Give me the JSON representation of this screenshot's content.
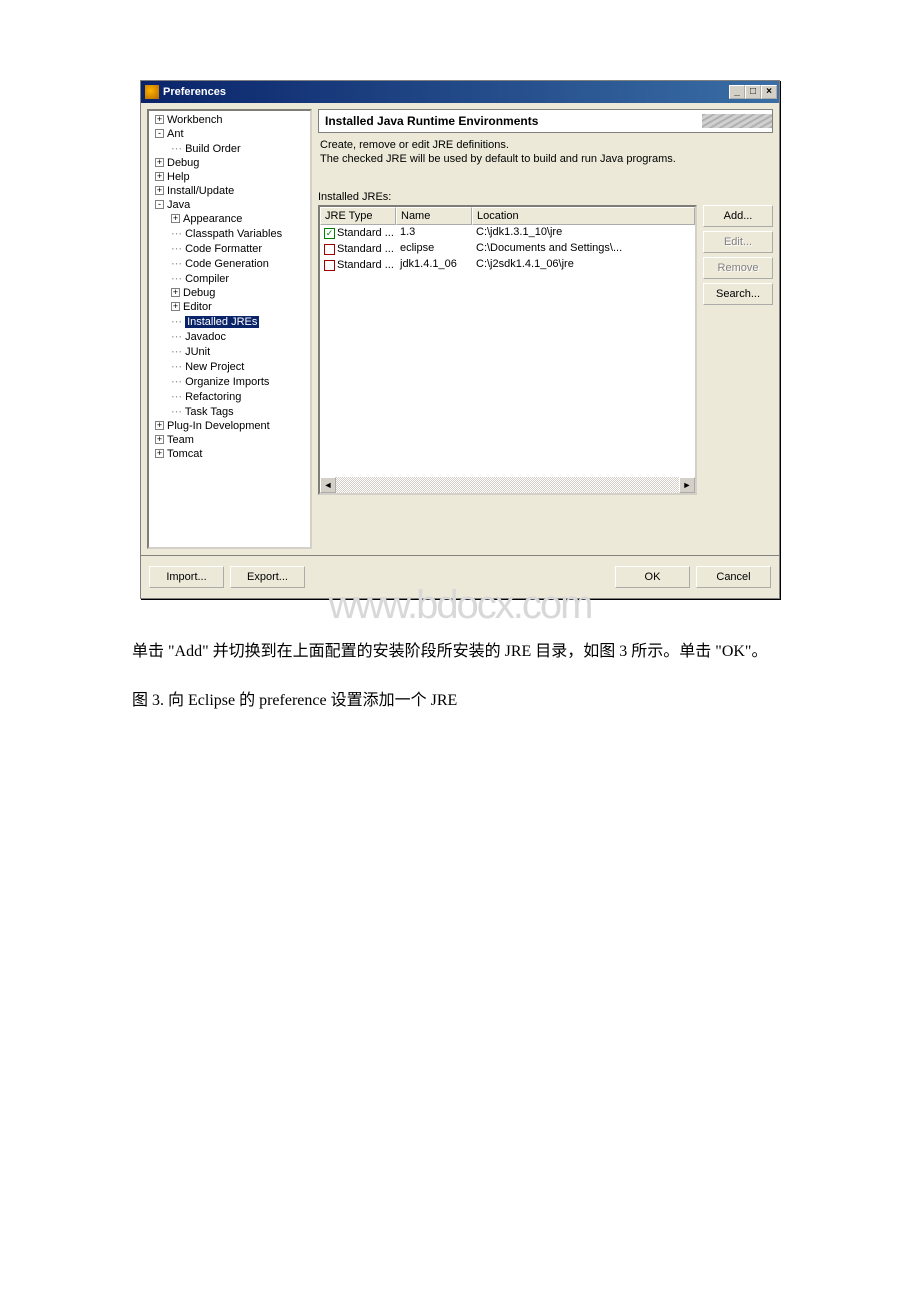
{
  "dialog": {
    "title": "Preferences",
    "titlebar_buttons": {
      "min": "_",
      "max": "□",
      "close": "×"
    }
  },
  "tree": {
    "items": [
      {
        "level": 0,
        "expander": "+",
        "label": "Workbench"
      },
      {
        "level": 0,
        "expander": "-",
        "label": "Ant"
      },
      {
        "level": 1,
        "expander": "",
        "label": "Build Order",
        "leaf": true
      },
      {
        "level": 0,
        "expander": "+",
        "label": "Debug"
      },
      {
        "level": 0,
        "expander": "+",
        "label": "Help"
      },
      {
        "level": 0,
        "expander": "+",
        "label": "Install/Update"
      },
      {
        "level": 0,
        "expander": "-",
        "label": "Java"
      },
      {
        "level": 1,
        "expander": "+",
        "label": "Appearance"
      },
      {
        "level": 1,
        "expander": "",
        "label": "Classpath Variables",
        "leaf": true
      },
      {
        "level": 1,
        "expander": "",
        "label": "Code Formatter",
        "leaf": true
      },
      {
        "level": 1,
        "expander": "",
        "label": "Code Generation",
        "leaf": true
      },
      {
        "level": 1,
        "expander": "",
        "label": "Compiler",
        "leaf": true
      },
      {
        "level": 1,
        "expander": "+",
        "label": "Debug"
      },
      {
        "level": 1,
        "expander": "+",
        "label": "Editor"
      },
      {
        "level": 1,
        "expander": "",
        "label": "Installed JREs",
        "leaf": true,
        "selected": true
      },
      {
        "level": 1,
        "expander": "",
        "label": "Javadoc",
        "leaf": true
      },
      {
        "level": 1,
        "expander": "",
        "label": "JUnit",
        "leaf": true
      },
      {
        "level": 1,
        "expander": "",
        "label": "New Project",
        "leaf": true
      },
      {
        "level": 1,
        "expander": "",
        "label": "Organize Imports",
        "leaf": true
      },
      {
        "level": 1,
        "expander": "",
        "label": "Refactoring",
        "leaf": true
      },
      {
        "level": 1,
        "expander": "",
        "label": "Task Tags",
        "leaf": true
      },
      {
        "level": 0,
        "expander": "+",
        "label": "Plug-In Development"
      },
      {
        "level": 0,
        "expander": "+",
        "label": "Team"
      },
      {
        "level": 0,
        "expander": "+",
        "label": "Tomcat"
      }
    ]
  },
  "panel": {
    "heading": "Installed Java Runtime Environments",
    "desc1": "Create, remove or edit JRE definitions.",
    "desc2": "The checked JRE will be used by default to build and run Java programs.",
    "list_label": "Installed JREs:",
    "columns": {
      "type": "JRE Type",
      "name": "Name",
      "location": "Location"
    },
    "rows": [
      {
        "checked": true,
        "color": "green",
        "type": "Standard ...",
        "name": "1.3",
        "location": "C:\\jdk1.3.1_10\\jre"
      },
      {
        "checked": false,
        "color": "red",
        "type": "Standard ...",
        "name": "eclipse",
        "location": "C:\\Documents and Settings\\..."
      },
      {
        "checked": false,
        "color": "red",
        "type": "Standard ...",
        "name": "jdk1.4.1_06",
        "location": "C:\\j2sdk1.4.1_06\\jre"
      }
    ],
    "buttons": {
      "add": "Add...",
      "edit": "Edit...",
      "remove": "Remove",
      "search": "Search..."
    }
  },
  "bottom": {
    "import": "Import...",
    "export": "Export...",
    "ok": "OK",
    "cancel": "Cancel"
  },
  "watermark": "www.bdocx.com",
  "article": {
    "p1": "单击 \"Add\" 并切换到在上面配置的安装阶段所安装的 JRE 目录，如图 3 所示。单击 \"OK\"。",
    "p2": "图 3. 向 Eclipse 的 preference 设置添加一个 JRE"
  }
}
